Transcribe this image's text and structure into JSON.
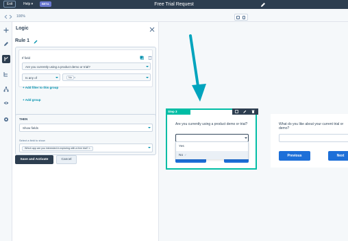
{
  "topbar": {
    "exit_label": "Exit",
    "help_label": "Help ▾",
    "beta_label": "BETA",
    "title": "Free Trial Request"
  },
  "toolbar": {
    "zoom_level": "100%"
  },
  "panel": {
    "title": "Logic",
    "rule_title": "Rule 1",
    "if_label": "If field",
    "field_value": "Are you currently using a product demo or trial?",
    "operator_value": "Is any of",
    "value_chip": "No",
    "value_chip_remove": "×",
    "add_filter_label": "+ Add filter to this group",
    "add_group_label": "+ Add group",
    "then_label": "THEN",
    "action_value": "Show fields",
    "select_field_label": "Select a field to show",
    "target_chip": "Which app are you interested in exploring with a free trial?  ×",
    "save_label": "Save and Activate",
    "cancel_label": "Cancel"
  },
  "canvas": {
    "step_tag": "Step 3",
    "question": "Are you currently using a product demo or trial?",
    "options": [
      "Yes",
      "No"
    ],
    "selected_option_tick": "✓",
    "next_question": "What do you like about your current trial or demo?",
    "previous_label": "Previous",
    "next_label": "Next"
  },
  "colors": {
    "topbar": "#2d3e50",
    "accent_teal": "#00bda5",
    "link_blue": "#0091ae",
    "button_blue": "#1d6fd8",
    "arrow_cyan": "#00a4bd"
  }
}
